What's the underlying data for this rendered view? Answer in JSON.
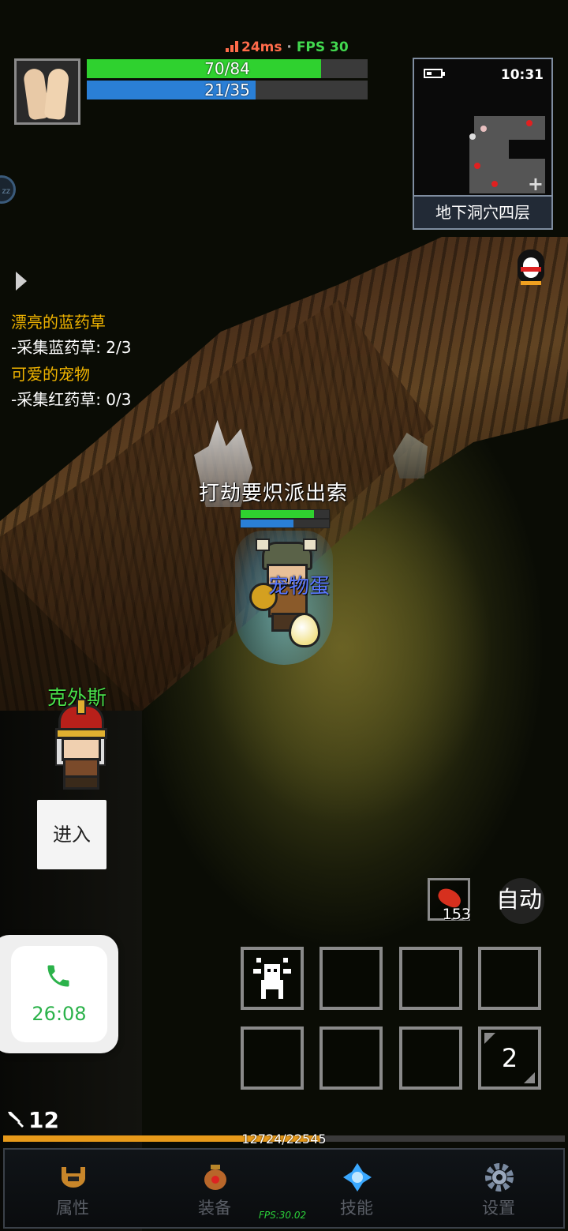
{
  "network": {
    "ping": "24ms",
    "separator": "·",
    "fps": "FPS 30"
  },
  "player_stats": {
    "hp_text": "70/84",
    "hp_fraction": 0.833,
    "mp_text": "21/35",
    "mp_fraction": 0.6
  },
  "minimap": {
    "time": "10:31",
    "area_name": "地下洞穴四层",
    "zoom_icon": "plus-icon"
  },
  "sleep_badge": "zz",
  "quests": [
    {
      "title": "漂亮的蓝药草",
      "task": "-采集蓝药草: 2/3"
    },
    {
      "title": "可爱的宠物",
      "task": "-采集红药草: 0/3"
    }
  ],
  "player": {
    "name": "打劫要炽派出索",
    "hp_fraction": 0.83,
    "mp_fraction": 0.6
  },
  "pet": {
    "label": "宠物蛋"
  },
  "npc": {
    "name": "克外斯",
    "action_label": "进入"
  },
  "call": {
    "duration": "26:08",
    "icon": "phone-icon",
    "accent": "#2bb24a"
  },
  "consumable": {
    "count": "153",
    "icon": "meat-icon"
  },
  "auto_label": "自动",
  "skill_slots": [
    {
      "icon": "monster-skill-icon",
      "label": ""
    },
    {
      "icon": "",
      "label": ""
    },
    {
      "icon": "",
      "label": ""
    },
    {
      "icon": "",
      "label": ""
    },
    {
      "icon": "",
      "label": ""
    },
    {
      "icon": "",
      "label": ""
    },
    {
      "icon": "",
      "label": ""
    },
    {
      "icon": "page-switch-icon",
      "label": "2"
    }
  ],
  "level": "12",
  "experience": {
    "text": "12724/22545",
    "fraction": 0.564
  },
  "bottom_nav": [
    {
      "label": "属性",
      "icon": "helmet-icon"
    },
    {
      "label": "装备",
      "icon": "bag-icon"
    },
    {
      "label": "技能",
      "icon": "crystal-icon"
    },
    {
      "label": "设置",
      "icon": "gear-icon"
    }
  ],
  "debug_fps": "FPS:30.02",
  "colors": {
    "hp": "#2fd12f",
    "mp": "#2a7fd6",
    "quest_title": "#f0b400",
    "npc_name": "#4ae04a",
    "pet_label": "#5a78ff",
    "exp": "#e89a1a"
  }
}
